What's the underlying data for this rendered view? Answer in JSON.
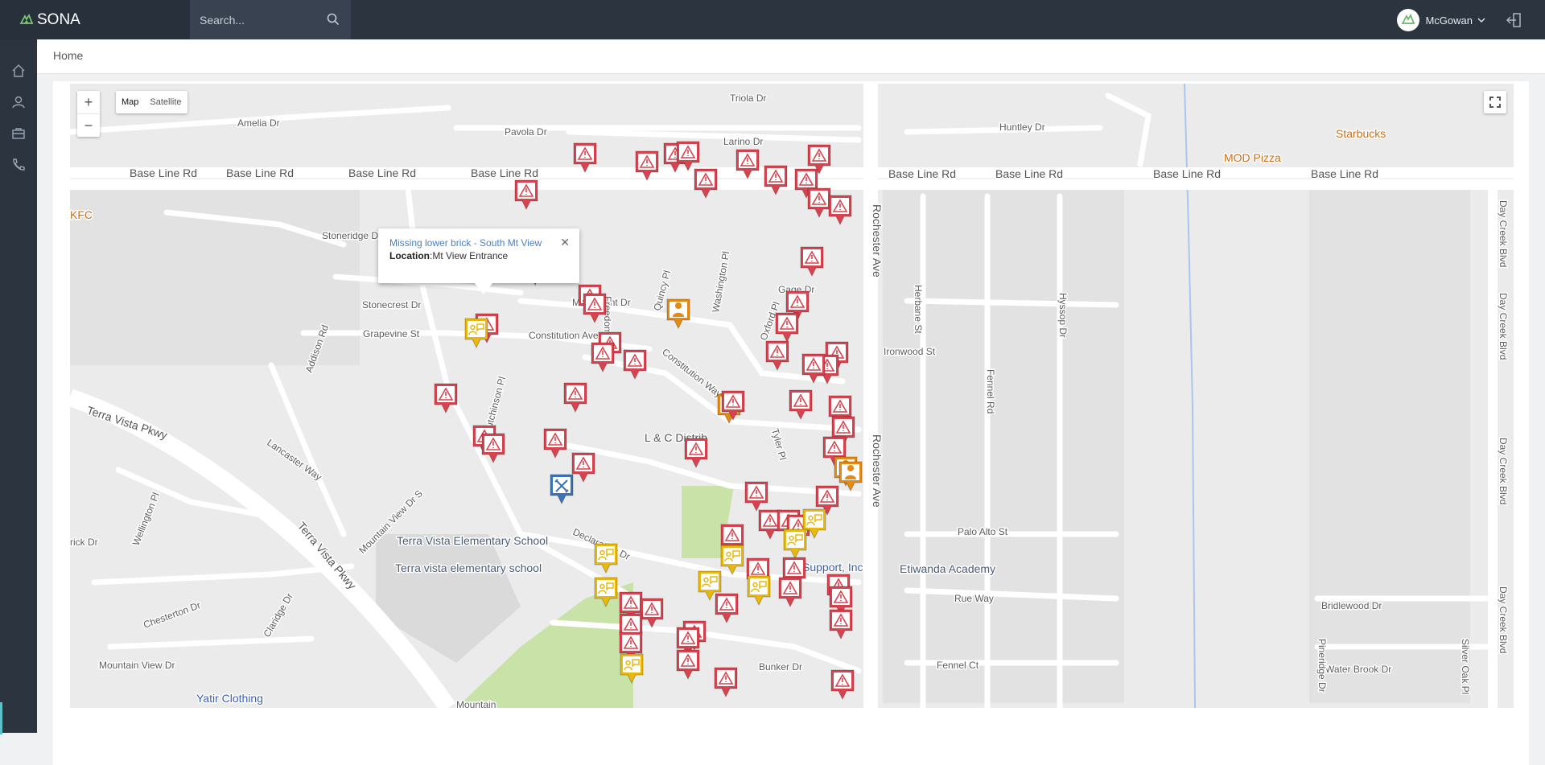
{
  "app": {
    "name": "SONA"
  },
  "search": {
    "placeholder": "Search..."
  },
  "user": {
    "name": "McGowan"
  },
  "breadcrumb": {
    "current": "Home"
  },
  "map_controls": {
    "zoom_in": "+",
    "zoom_out": "−",
    "map_label": "Map",
    "satellite_label": "Satellite"
  },
  "popup": {
    "title": "Missing lower brick - South Mt View",
    "location_label": "Location",
    "location_value": "Mt View Entrance",
    "close": "✕"
  },
  "map_labels": {
    "base_line_rd": "Base Line Rd",
    "amelia": "Amelia Dr",
    "pavola": "Pavola Dr",
    "larino": "Larino Dr",
    "triola": "Triola Dr",
    "huntley": "Huntley Dr",
    "starbucks": "Starbucks",
    "mod_pizza": "MOD Pizza",
    "kfc": "KFC",
    "stoneridge": "Stoneridge Dr",
    "stonecrest": "Stonecrest Dr",
    "grapevine": "Grapevine St",
    "monument": "Monument Dr",
    "constitution_ave": "Constitution Ave",
    "constitution_way": "Constitution Way",
    "declaration": "Declaration Dr",
    "lc_distrib": "L & C Distrib",
    "terra_vista_pkwy": "Terra Vista Pkwy",
    "lancaster": "Lancaster Way",
    "mountain_view_s": "Mountain View Dr S",
    "mountain_view_dr": "Mountain View Dr",
    "chesterton": "Chesterton Dr",
    "terra_vista_es": "Terra Vista Elementary School",
    "terra_vista_es2": "Terra vista elementary school",
    "yatir": "Yatir Clothing",
    "rochester": "Rochester Ave",
    "ironwood": "Ironwood St",
    "palo_alto": "Palo Alto St",
    "etiwanda": "Etiwanda Academy",
    "rue_way": "Rue Way",
    "fennel_ct": "Fennel Ct",
    "bridlewood": "Bridlewood Dr",
    "water_brook": "Water Brook Dr",
    "day_creek": "Day Creek Blvd",
    "support_inc": "Support, Inc",
    "bunker": "Bunker Dr",
    "gage": "Gage Dr",
    "hutchinson": "Hutchinson Pl",
    "freedom": "Freedom Pl",
    "quincy": "Quincy Pl",
    "washington": "Washington Pl",
    "oxford": "Oxford Pl",
    "tyler": "Tyler Pl",
    "addison": "Addison Rd",
    "wellington": "Wellington Pl",
    "hyssop": "Hyssop Dr",
    "fennel_rd": "Fennel Rd",
    "herbane": "Herbane St",
    "pineridge": "Pineridge Dr",
    "silver_oak": "Silver Oak Pl",
    "rick": "rick Dr",
    "claridge": "Claridge Dr",
    "mountain_bottom": "Mountain"
  },
  "colors": {
    "topbar": "#2c3440",
    "sidebar": "#2c3440",
    "pin_red": "#d9434f",
    "pin_orange": "#e58a13",
    "pin_yellow": "#e8b80f",
    "pin_blue": "#3b73b9",
    "accent": "#5cc0c7"
  }
}
